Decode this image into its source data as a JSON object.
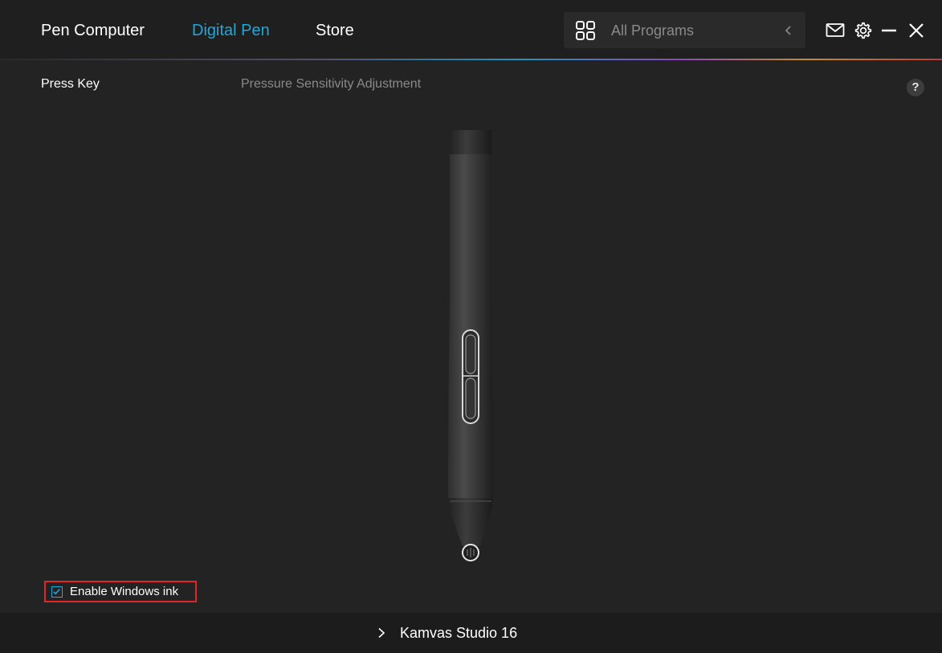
{
  "header": {
    "tabs": [
      {
        "label": "Pen Computer",
        "active": false
      },
      {
        "label": "Digital Pen",
        "active": true
      },
      {
        "label": "Store",
        "active": false
      }
    ],
    "program_selector": {
      "label": "All Programs",
      "icon": "grid-icon",
      "chevron": "chevron-left-icon"
    },
    "actions": [
      {
        "icon": "mail-icon"
      },
      {
        "icon": "gear-icon"
      },
      {
        "icon": "minimize-icon"
      },
      {
        "icon": "close-icon"
      }
    ]
  },
  "sub_tabs": [
    {
      "label": "Press Key",
      "active": true
    },
    {
      "label": "Pressure Sensitivity Adjustment",
      "active": false
    }
  ],
  "help": {
    "label": "?"
  },
  "windows_ink": {
    "label": "Enable Windows ink",
    "checked": true
  },
  "footer": {
    "device_label": "Kamvas Studio 16"
  },
  "colors": {
    "accent": "#1fa8d8",
    "background": "#232323",
    "highlight_border": "#e0262b"
  }
}
